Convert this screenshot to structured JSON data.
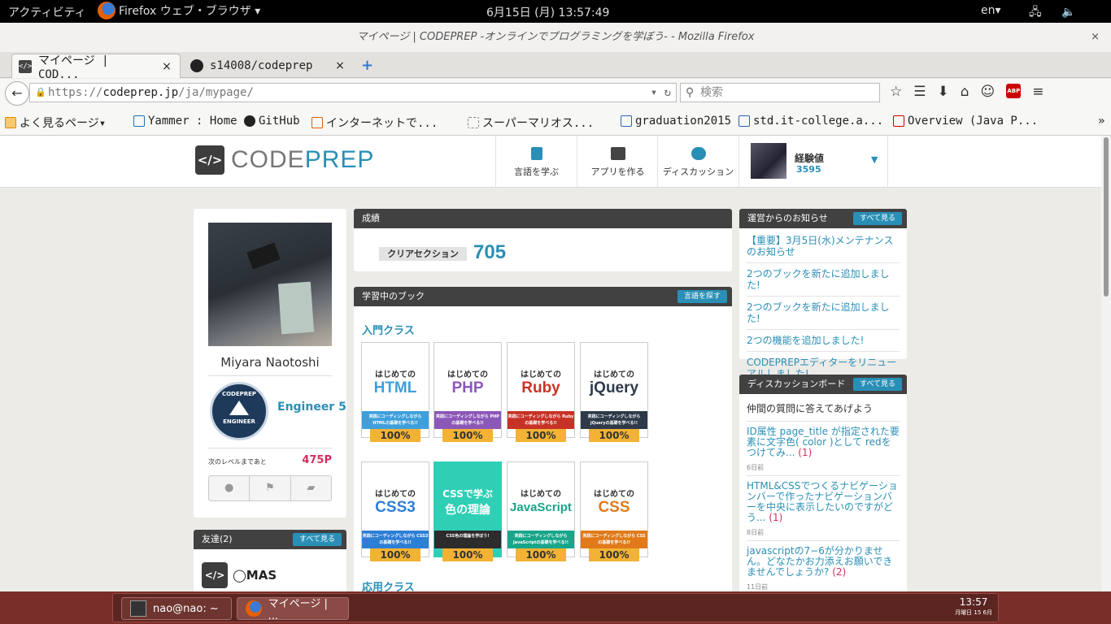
{
  "topbar": {
    "activities": "アクティビティ",
    "app_menu": "Firefox ウェブ・ブラウザ ▾",
    "clock": "6月15日 (月) 13:57:49",
    "lang": "en▾",
    "sys_icons": "🖧 🔈 ⏻▾"
  },
  "window": {
    "title": "マイページ | CODEPREP -オンラインでプログラミングを学ぼう- - Mozilla Firefox",
    "close": "×"
  },
  "tabs": [
    {
      "label": "マイページ | COD...",
      "close": "×"
    },
    {
      "label": "s14008/codeprep",
      "close": "×"
    }
  ],
  "new_tab": "+",
  "nav": {
    "back": "←",
    "url_scheme": "https://",
    "url_host": "codeprep.jp",
    "url_path": "/ja/mypage/",
    "url_controls": "▾ ↻",
    "search_placeholder": "検索",
    "icons": [
      "☆",
      "☰",
      "⬇",
      "⌂",
      "☺",
      "ABP",
      "≡"
    ]
  },
  "bookmarks": [
    {
      "label": "よく見るページ▾",
      "color": "#e08a00"
    },
    {
      "label": "Yammer : Home",
      "color": "#1a73b8"
    },
    {
      "label": "GitHub",
      "color": "#222222"
    },
    {
      "label": "インターネットで...",
      "color": "#e06000"
    },
    {
      "label": "スーパーマリオス...",
      "color": "#888888"
    },
    {
      "label": "graduation2015",
      "color": "#2b66b0"
    },
    {
      "label": "std.it-college.a...",
      "color": "#2b66b0"
    },
    {
      "label": "Overview (Java P...",
      "color": "#cc0000"
    }
  ],
  "bookmarks_more": "»",
  "site": {
    "logo_mark": "</>",
    "logo_a": "CODE",
    "logo_b": "PREP",
    "nav": [
      {
        "label": "言語を学ぶ"
      },
      {
        "label": "アプリを作る"
      },
      {
        "label": "ディスカッション"
      }
    ],
    "xp_label": "経験値",
    "xp_value": "3595",
    "caret": "▼"
  },
  "profile": {
    "name": "Miyara Naotoshi",
    "badge_top": "CODEPREP",
    "badge_bottom": "ENGINEER",
    "level": "Engineer 5",
    "next_label": "次のレベルまであと",
    "next_value": "475P"
  },
  "friends": {
    "title": "友達(2)",
    "button": "すべて見る"
  },
  "score": {
    "title": "成績",
    "label": "クリアセクション",
    "value": "705"
  },
  "books": {
    "title": "学習中のブック",
    "button": "言語を探す",
    "intro": "入門クラス",
    "applied": "応用クラス",
    "items": [
      {
        "t1": "はじめての",
        "t2": "HTML",
        "band": "実践にコーディングしながら HTMLの基礎を学べる!!",
        "pct": "100%",
        "color": "#3f9fdc"
      },
      {
        "t1": "はじめての",
        "t2": "PHP",
        "band": "実践にコーディングしながら PHPの基礎を学べる!!",
        "pct": "100%",
        "color": "#8c58b8"
      },
      {
        "t1": "はじめての",
        "t2": "Ruby",
        "band": "実践にコーディングしながら Rubyの基礎を学べる!!",
        "pct": "100%",
        "color": "#c63326"
      },
      {
        "t1": "はじめての",
        "t2": "jQuery",
        "band": "実践にコーディングしながら jQueryの基礎を学べる!!",
        "pct": "100%",
        "color": "#2e3a4a"
      },
      {
        "t1": "はじめての",
        "t2": "CSS3",
        "band": "実践にコーディングしながら CSS3の基礎を学べる!!",
        "pct": "100%",
        "color": "#2d7fd6"
      },
      {
        "t1": "CSSで学ぶ",
        "t2": "色の理論",
        "band": "CSS色の理論を学ぼう!",
        "pct": "100%",
        "color": "#2c2c2c"
      },
      {
        "t1": "はじめての",
        "t2": "JavaScript",
        "band": "実践にコーディングしながら JavaScriptの基礎を学べる!!",
        "pct": "100%",
        "color": "#18a58a"
      },
      {
        "t1": "はじめての",
        "t2": "CSS",
        "band": "実践にコーディングしながら CSSの基礎を学べる!!",
        "pct": "100%",
        "color": "#e07a1a"
      }
    ]
  },
  "news": {
    "title": "運営からのお知らせ",
    "button": "すべて見る",
    "items": [
      "【重要】3月5日(水)メンテナンスのお知らせ",
      "2つのブックを新たに追加しました!",
      "2つのブックを新たに追加しました!",
      "2つの機能を追加しました!",
      "CODEPREPエディターをリニューアルしました!"
    ]
  },
  "discussion": {
    "title": "ディスカッションボード",
    "button": "すべて見る",
    "prompt": "仲間の質問に答えてあげよう",
    "items": [
      {
        "q": "ID属性 page_title が指定された要素に文字色( color )として redをつけてみ...",
        "n": "(1)",
        "ago": "6日前"
      },
      {
        "q": "HTML&CSSでつくるナビゲーションバーで作ったナビゲーションバーを中央に表示したいのですがどう...",
        "n": "(1)",
        "ago": "8日前"
      },
      {
        "q": "javascriptの7−6が分かりません。どなたかお力添えお願いできませんでしょうか?",
        "n": "(2)",
        "ago": "11日前"
      }
    ]
  },
  "taskbar": {
    "items": [
      {
        "label": "nao@nao: ~"
      },
      {
        "label": "マイページ | ..."
      }
    ],
    "time": "13:57",
    "date": "月曜日 15 6月"
  }
}
